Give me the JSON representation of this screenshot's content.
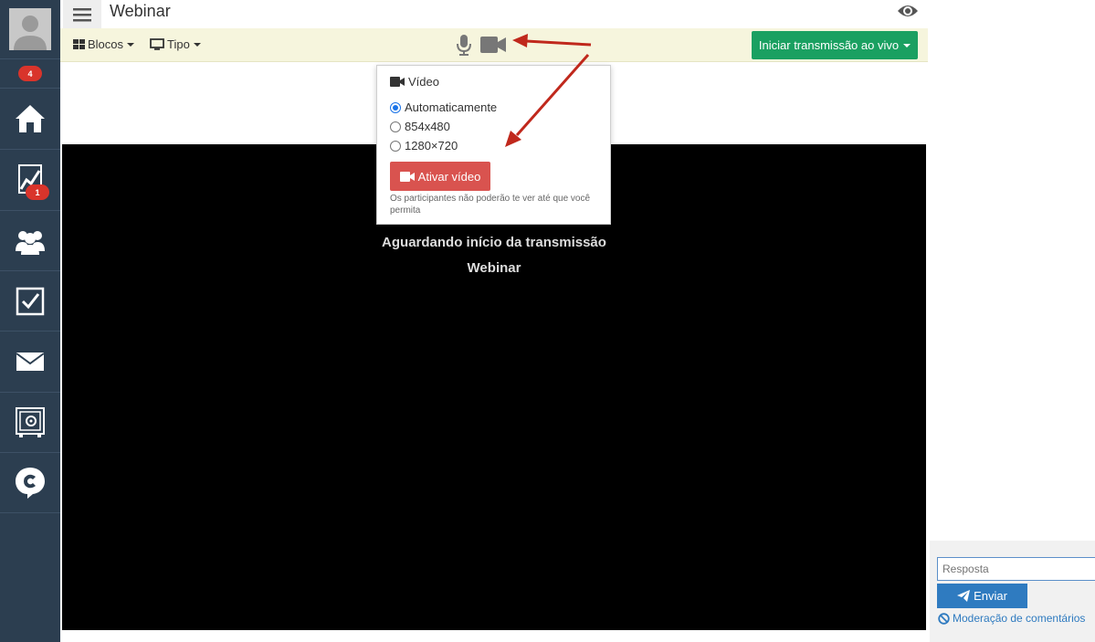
{
  "sidebar": {
    "badges": {
      "notifications": "4",
      "stats": "1"
    },
    "items": [
      {
        "name": "avatar",
        "icon": "user-avatar-icon"
      },
      {
        "name": "home",
        "icon": "home-icon"
      },
      {
        "name": "stats",
        "icon": "chart-icon"
      },
      {
        "name": "users",
        "icon": "users-icon"
      },
      {
        "name": "tasks",
        "icon": "checkbox-icon"
      },
      {
        "name": "mail",
        "icon": "mail-icon"
      },
      {
        "name": "safe",
        "icon": "safe-icon"
      },
      {
        "name": "chat",
        "icon": "chat-logo-icon"
      }
    ]
  },
  "header": {
    "title": "Webinar",
    "eye_icon": "eye-icon",
    "menu_icon": "hamburger-icon"
  },
  "toolbar": {
    "blocks_label": "Blocos",
    "type_label": "Tipo",
    "mic_icon": "microphone-icon",
    "cam_icon": "video-camera-icon",
    "live_button": "Iniciar transmissão ao vivo"
  },
  "video_popover": {
    "title": "Vídeo",
    "options": [
      "Automaticamente",
      "854x480",
      "1280×720"
    ],
    "selected": "Automaticamente",
    "activate_button": "Ativar vídeo",
    "note": "Os participantes não poderão te ver até que você permita"
  },
  "player": {
    "waiting": "Aguardando início da transmissão",
    "event_name": "Webinar"
  },
  "chat_panel": {
    "reply_placeholder": "Resposta",
    "send_button": "Enviar",
    "moderation_link": "Moderação de comentários"
  },
  "colors": {
    "sidebar": "#2c3e50",
    "toolbar": "#f6f5dd",
    "live_button": "#1aa061",
    "activate_button": "#d9534f",
    "send_button": "#2f7bc0",
    "annotation_arrow": "#c0281c",
    "badge": "#d9342b"
  }
}
